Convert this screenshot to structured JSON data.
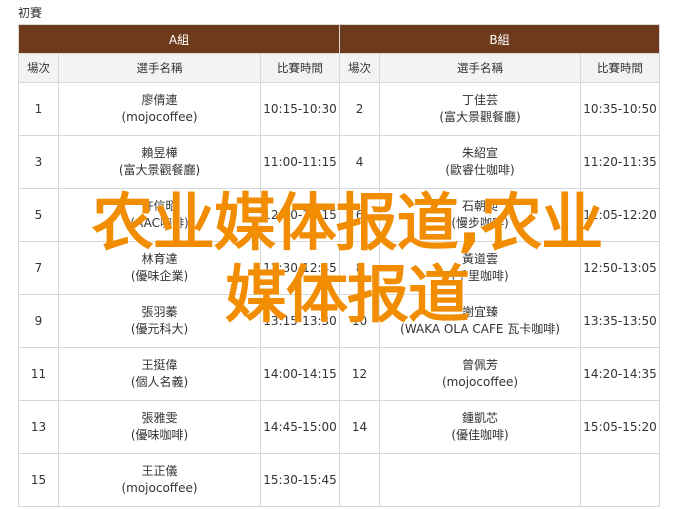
{
  "heading": "初賽",
  "groups": [
    {
      "label": "A組"
    },
    {
      "label": "B組"
    }
  ],
  "columns": {
    "order": "場次",
    "player": "選手名稱",
    "time": "比賽時間"
  },
  "rows": [
    {
      "a": {
        "no": "1",
        "name": "廖倩連",
        "team": "(mojocoffee)",
        "time": "10:15-10:30"
      },
      "b": {
        "no": "2",
        "name": "丁佳芸",
        "team": "(富大景觀餐廳)",
        "time": "10:35-10:50"
      }
    },
    {
      "a": {
        "no": "3",
        "name": "賴昱樺",
        "team": "(富大景觀餐廳)",
        "time": "11:00-11:15"
      },
      "b": {
        "no": "4",
        "name": "朱紹宣",
        "team": "(歐睿仕咖啡)",
        "time": "11:20-11:35"
      }
    },
    {
      "a": {
        "no": "5",
        "name": "許信昭",
        "team": "(AAC咖啡)",
        "time": "12:00-12:15"
      },
      "b": {
        "no": "6",
        "name": "石朝昶",
        "team": "(慢步咖啡)",
        "time": "12:05-12:20"
      }
    },
    {
      "a": {
        "no": "7",
        "name": "林育達",
        "team": "(優味企業)",
        "time": "12:30-12:45"
      },
      "b": {
        "no": "8",
        "name": "黃道雲",
        "team": "(千里咖啡)",
        "time": "12:50-13:05"
      }
    },
    {
      "a": {
        "no": "9",
        "name": "張羽蓁",
        "team": "(優元科大)",
        "time": "13:15-13:30"
      },
      "b": {
        "no": "10",
        "name": "謝宜臻",
        "team": "(WAKA OLA CAFE 瓦卡咖啡)",
        "time": "13:35-13:50"
      }
    },
    {
      "a": {
        "no": "11",
        "name": "王挺偉",
        "team": "(個人名義)",
        "time": "14:00-14:15"
      },
      "b": {
        "no": "12",
        "name": "曾佩芳",
        "team": "(mojocoffee)",
        "time": "14:20-14:35"
      }
    },
    {
      "a": {
        "no": "13",
        "name": "張雅雯",
        "team": "(優味咖啡)",
        "time": "14:45-15:00"
      },
      "b": {
        "no": "14",
        "name": "鍾凱芯",
        "team": "(優佳咖啡)",
        "time": "15:05-15:20"
      }
    },
    {
      "a": {
        "no": "15",
        "name": "王正儀",
        "team": "(mojocoffee)",
        "time": "15:30-15:45"
      },
      "b": {
        "no": "",
        "name": "",
        "team": "",
        "time": ""
      }
    }
  ],
  "watermark": {
    "line1": "农业媒体报道,农业",
    "line2": "媒体报道"
  },
  "colors": {
    "group_header_bg": "#6e3a1c",
    "column_header_bg": "#f3f3f3",
    "watermark": "#f28c00"
  }
}
